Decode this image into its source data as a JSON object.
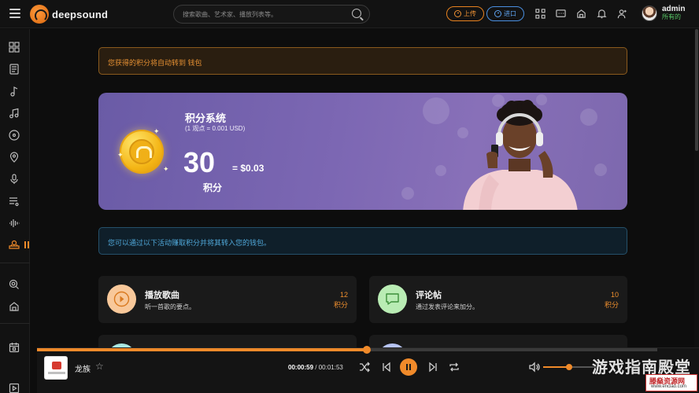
{
  "header": {
    "logo_text": "deepsound",
    "search_placeholder": "搜索歌曲、艺术家、播放列表等。",
    "upload_label": "上传",
    "import_label": "进口",
    "user": {
      "name": "admin",
      "role": "所有的"
    }
  },
  "notices": {
    "wallet_notice": "您获得的积分将自动转到 钱包",
    "earn_notice": "您可以通过以下活动赚取积分并将其转入您的钱包。"
  },
  "points_system": {
    "title": "积分系统",
    "rate": "(1 观点 = 0.001 USD)",
    "points": "30",
    "equals": "= $0.03",
    "unit": "积分"
  },
  "activities": [
    {
      "title": "播放歌曲",
      "desc": "听一首歌的要点。",
      "points": "12",
      "unit": "积分",
      "icon": "play-icon",
      "icon_bg": "#f8c89a"
    },
    {
      "title": "评论帖",
      "desc": "通过发表评论来加分。",
      "points": "10",
      "unit": "积分",
      "icon": "comment-icon",
      "icon_bg": "#b9ecb4"
    }
  ],
  "player": {
    "track": "龙族",
    "current_time": "00:00:59",
    "separator": " / ",
    "total_time": "00:01:53",
    "progress": 0.532,
    "volume": 0.47
  },
  "watermark": {
    "main": "游戏指南殿堂",
    "brand": "滕燊资源网",
    "url": "www.enciao.com"
  },
  "colors": {
    "accent": "#f08a2a",
    "info": "#4fa7d8",
    "hero_bg": "#7c67b3"
  }
}
